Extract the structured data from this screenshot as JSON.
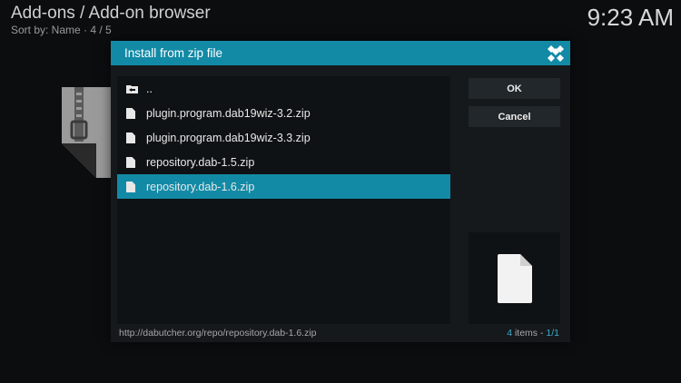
{
  "header": {
    "title": "Add-ons / Add-on browser",
    "subtitle": "Sort by: Name  ·  4 / 5",
    "clock": "9:23 AM"
  },
  "dialog": {
    "title": "Install from zip file",
    "items": [
      {
        "label": "..",
        "type": "folder-up",
        "selected": false
      },
      {
        "label": "plugin.program.dab19wiz-3.2.zip",
        "type": "file",
        "selected": false
      },
      {
        "label": "plugin.program.dab19wiz-3.3.zip",
        "type": "file",
        "selected": false
      },
      {
        "label": "repository.dab-1.5.zip",
        "type": "file",
        "selected": false
      },
      {
        "label": "repository.dab-1.6.zip",
        "type": "file",
        "selected": true
      }
    ],
    "ok_label": "OK",
    "cancel_label": "Cancel",
    "path": "http://dabutcher.org/repo/repository.dab-1.6.zip",
    "count_number": "4",
    "count_text": " items - ",
    "page": "1/1"
  },
  "colors": {
    "accent": "#128aa6",
    "background": "#0b0d0f",
    "dialog": "#15191c"
  }
}
